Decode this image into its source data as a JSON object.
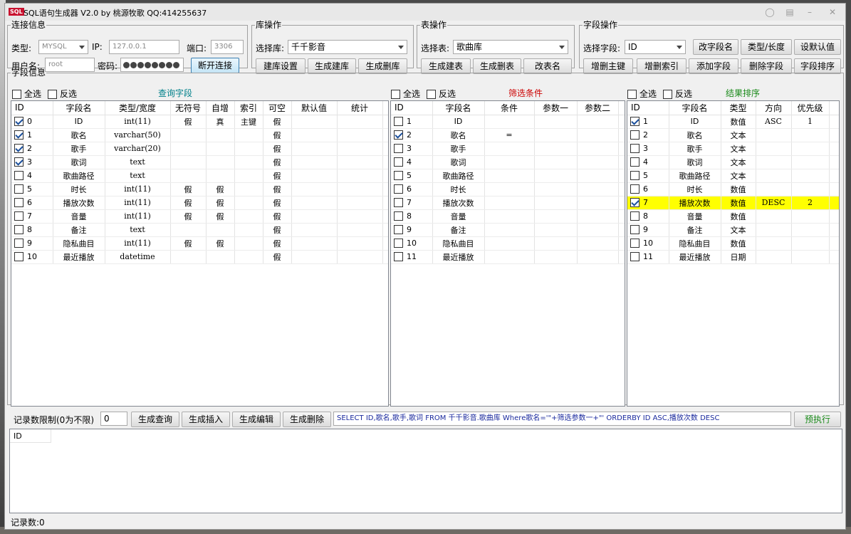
{
  "window": {
    "app_logo": "SQL",
    "title": "SQL语句生成器 V2.0 by 桃源牧歌  QQ:414255637"
  },
  "conn": {
    "legend": "连接信息",
    "type_label": "类型:",
    "type_value": "MYSQL",
    "ip_label": "IP:",
    "ip_value": "127.0.0.1",
    "port_label": "端口:",
    "port_value": "3306",
    "user_label": "用户名:",
    "user_value": "root",
    "pwd_label": "密码:",
    "disconnect": "断开连接"
  },
  "db": {
    "legend": "库操作",
    "select_label": "选择库:",
    "select_value": "千千影音",
    "btn_settings": "建库设置",
    "btn_create": "生成建库",
    "btn_drop": "生成删库"
  },
  "tbl": {
    "legend": "表操作",
    "select_label": "选择表:",
    "select_value": "歌曲库",
    "btn_create": "生成建表",
    "btn_drop": "生成删表",
    "btn_rename": "改表名"
  },
  "field": {
    "legend": "字段操作",
    "select_label": "选择字段:",
    "select_value": "ID",
    "buttons": [
      "改字段名",
      "类型/长度",
      "设默认值",
      "增删主键",
      "增删索引",
      "添加字段",
      "删除字段",
      "字段排序"
    ]
  },
  "fields": {
    "legend": "字段信息",
    "select_all": "全选",
    "invert": "反选",
    "query": {
      "title": "查询字段",
      "title_color": "#00808a",
      "columns": [
        "ID",
        "字段名",
        "类型/宽度",
        "无符号",
        "自增",
        "索引",
        "可空",
        "默认值",
        "统计"
      ],
      "rows": [
        {
          "checked": true,
          "cells": [
            "0",
            "ID",
            "int(11)",
            "假",
            "真",
            "主键",
            "假",
            "",
            ""
          ]
        },
        {
          "checked": true,
          "cells": [
            "1",
            "歌名",
            "varchar(50)",
            "",
            "",
            "",
            "假",
            "",
            ""
          ]
        },
        {
          "checked": true,
          "cells": [
            "2",
            "歌手",
            "varchar(20)",
            "",
            "",
            "",
            "假",
            "",
            ""
          ]
        },
        {
          "checked": true,
          "cells": [
            "3",
            "歌词",
            "text",
            "",
            "",
            "",
            "假",
            "",
            ""
          ]
        },
        {
          "checked": false,
          "cells": [
            "4",
            "歌曲路径",
            "text",
            "",
            "",
            "",
            "假",
            "",
            ""
          ]
        },
        {
          "checked": false,
          "cells": [
            "5",
            "时长",
            "int(11)",
            "假",
            "假",
            "",
            "假",
            "",
            ""
          ]
        },
        {
          "checked": false,
          "cells": [
            "6",
            "播放次数",
            "int(11)",
            "假",
            "假",
            "",
            "假",
            "",
            ""
          ]
        },
        {
          "checked": false,
          "cells": [
            "7",
            "音量",
            "int(11)",
            "假",
            "假",
            "",
            "假",
            "",
            ""
          ]
        },
        {
          "checked": false,
          "cells": [
            "8",
            "备注",
            "text",
            "",
            "",
            "",
            "假",
            "",
            ""
          ]
        },
        {
          "checked": false,
          "cells": [
            "9",
            "隐私曲目",
            "int(11)",
            "假",
            "假",
            "",
            "假",
            "",
            ""
          ]
        },
        {
          "checked": false,
          "cells": [
            "10",
            "最近播放",
            "datetime",
            "",
            "",
            "",
            "假",
            "",
            ""
          ]
        }
      ]
    },
    "filter": {
      "title": "筛选条件",
      "title_color": "#cc0000",
      "columns": [
        "ID",
        "字段名",
        "条件",
        "参数一",
        "参数二"
      ],
      "rows": [
        {
          "checked": false,
          "cells": [
            "1",
            "ID",
            "",
            "",
            ""
          ]
        },
        {
          "checked": true,
          "cells": [
            "2",
            "歌名",
            "=",
            "",
            ""
          ]
        },
        {
          "checked": false,
          "cells": [
            "3",
            "歌手",
            "",
            "",
            ""
          ]
        },
        {
          "checked": false,
          "cells": [
            "4",
            "歌词",
            "",
            "",
            ""
          ]
        },
        {
          "checked": false,
          "cells": [
            "5",
            "歌曲路径",
            "",
            "",
            ""
          ]
        },
        {
          "checked": false,
          "cells": [
            "6",
            "时长",
            "",
            "",
            ""
          ]
        },
        {
          "checked": false,
          "cells": [
            "7",
            "播放次数",
            "",
            "",
            ""
          ]
        },
        {
          "checked": false,
          "cells": [
            "8",
            "音量",
            "",
            "",
            ""
          ]
        },
        {
          "checked": false,
          "cells": [
            "9",
            "备注",
            "",
            "",
            ""
          ]
        },
        {
          "checked": false,
          "cells": [
            "10",
            "隐私曲目",
            "",
            "",
            ""
          ]
        },
        {
          "checked": false,
          "cells": [
            "11",
            "最近播放",
            "",
            "",
            ""
          ]
        }
      ]
    },
    "sort": {
      "title": "结果排序",
      "title_color": "#1a8a1a",
      "columns": [
        "ID",
        "字段名",
        "类型",
        "方向",
        "优先级"
      ],
      "rows": [
        {
          "checked": true,
          "highlight": false,
          "cells": [
            "1",
            "ID",
            "数值",
            "ASC",
            "1"
          ]
        },
        {
          "checked": false,
          "highlight": false,
          "cells": [
            "2",
            "歌名",
            "文本",
            "",
            ""
          ]
        },
        {
          "checked": false,
          "highlight": false,
          "cells": [
            "3",
            "歌手",
            "文本",
            "",
            ""
          ]
        },
        {
          "checked": false,
          "highlight": false,
          "cells": [
            "4",
            "歌词",
            "文本",
            "",
            ""
          ]
        },
        {
          "checked": false,
          "highlight": false,
          "cells": [
            "5",
            "歌曲路径",
            "文本",
            "",
            ""
          ]
        },
        {
          "checked": false,
          "highlight": false,
          "cells": [
            "6",
            "时长",
            "数值",
            "",
            ""
          ]
        },
        {
          "checked": true,
          "highlight": true,
          "cells": [
            "7",
            "播放次数",
            "数值",
            "DESC",
            "2"
          ]
        },
        {
          "checked": false,
          "highlight": false,
          "cells": [
            "8",
            "音量",
            "数值",
            "",
            ""
          ]
        },
        {
          "checked": false,
          "highlight": false,
          "cells": [
            "9",
            "备注",
            "文本",
            "",
            ""
          ]
        },
        {
          "checked": false,
          "highlight": false,
          "cells": [
            "10",
            "隐私曲目",
            "数值",
            "",
            ""
          ]
        },
        {
          "checked": false,
          "highlight": false,
          "cells": [
            "11",
            "最近播放",
            "日期",
            "",
            ""
          ]
        }
      ]
    }
  },
  "bottom": {
    "limit_label": "记录数限制(0为不限)",
    "limit_value": "0",
    "btn_query": "生成查询",
    "btn_insert": "生成插入",
    "btn_edit": "生成编辑",
    "btn_delete": "生成删除",
    "sql": "SELECT ID,歌名,歌手,歌词 FROM 千千影音.歌曲库 Where歌名='\"+筛选参数一+\"' ORDERBY ID ASC,播放次数 DESC",
    "btn_execute": "预执行",
    "execute_color": "#1a8a1a",
    "result_column": "ID",
    "record_count": "记录数:0"
  }
}
